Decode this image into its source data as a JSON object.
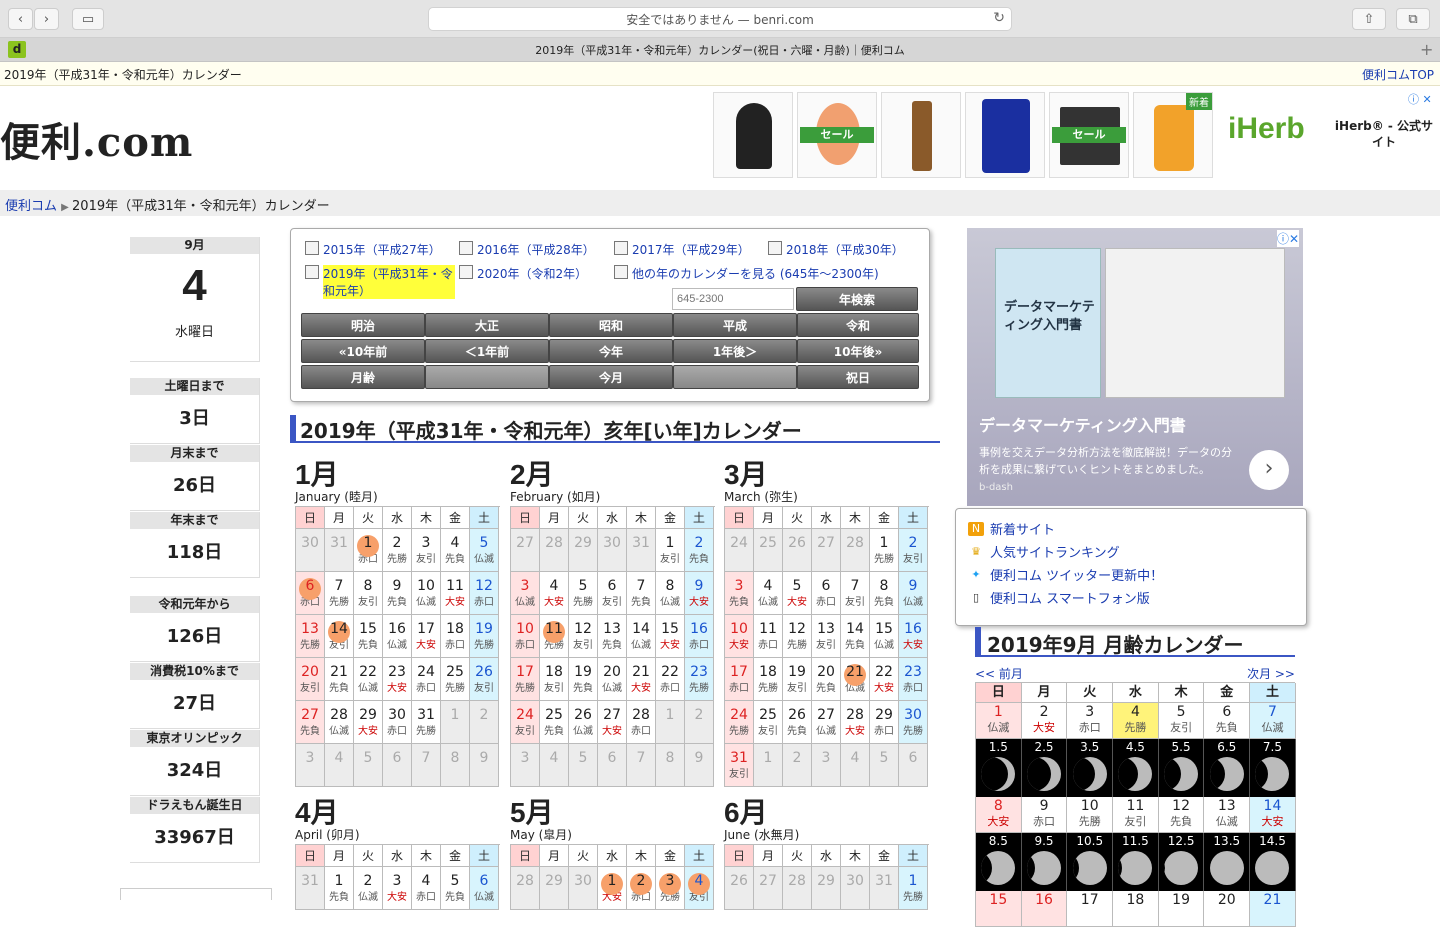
{
  "browser": {
    "url": "安全ではありません — benri.com",
    "tab_title": "2019年（平成31年・令和元年）カレンダー(祝日・六曜・月齢)｜便利コム",
    "favicon": "d"
  },
  "topbar": {
    "title": "2019年（平成31年・令和元年）カレンダー",
    "top_link": "便利コムTOP"
  },
  "header": {
    "logo": "便利.com",
    "ads": {
      "sale1": "セール",
      "sale2": "セール",
      "new": "新着",
      "iherb": "iHerb",
      "iherb_text": "iHerb® - 公式サイト"
    }
  },
  "breadcrumb": {
    "home": "便利コム",
    "current": "2019年（平成31年・令和元年）カレンダー"
  },
  "sidebar": {
    "today": {
      "month": "9月",
      "day": "4",
      "weekday": "水曜日"
    },
    "counters": [
      {
        "label": "土曜日まで",
        "value": "3日"
      },
      {
        "label": "月末まで",
        "value": "26日"
      },
      {
        "label": "年末まで",
        "value": "118日"
      },
      {
        "label": "令和元年から",
        "value": "126日"
      },
      {
        "label": "消費税10%まで",
        "value": "27日"
      },
      {
        "label": "東京オリンピック",
        "value": "324日"
      },
      {
        "label": "ドラえもん誕生日",
        "value": "33967日"
      }
    ]
  },
  "panel": {
    "years": [
      "2015年（平成27年）",
      "2016年（平成28年）",
      "2017年（平成29年）",
      "2018年（平成30年）",
      "2019年（平成31年・令和元年）",
      "2020年（令和2年）",
      "他の年のカレンダーを見る (645年〜2300年)"
    ],
    "year_placeholder": "645-2300",
    "search_button": "年検索",
    "row1": [
      "明治",
      "大正",
      "昭和",
      "平成",
      "令和"
    ],
    "row2": [
      "«10年前",
      "＜1年前",
      "今年",
      "1年後＞",
      "10年後»"
    ],
    "row3": [
      "月齢",
      "",
      "今月",
      "",
      "祝日"
    ]
  },
  "year_heading": "2019年（平成31年・令和元年）亥年[い年]カレンダー",
  "weekdays": [
    "日",
    "月",
    "火",
    "水",
    "木",
    "金",
    "土"
  ],
  "months": [
    {
      "name": "1月",
      "sub": "January (睦月)",
      "days": [
        [
          "30",
          "",
          ""
        ],
        [
          "31",
          "",
          ""
        ],
        [
          "1",
          "赤口",
          "h"
        ],
        [
          "2",
          "先勝",
          ""
        ],
        [
          "3",
          "友引",
          ""
        ],
        [
          "4",
          "先負",
          ""
        ],
        [
          "5",
          "仏滅",
          ""
        ],
        [
          "6",
          "赤口",
          "h"
        ],
        [
          "7",
          "先勝",
          ""
        ],
        [
          "8",
          "友引",
          ""
        ],
        [
          "9",
          "先負",
          ""
        ],
        [
          "10",
          "仏滅",
          ""
        ],
        [
          "11",
          "大安",
          ""
        ],
        [
          "12",
          "赤口",
          ""
        ],
        [
          "13",
          "先勝",
          ""
        ],
        [
          "14",
          "友引",
          "h"
        ],
        [
          "15",
          "先負",
          ""
        ],
        [
          "16",
          "仏滅",
          ""
        ],
        [
          "17",
          "大安",
          ""
        ],
        [
          "18",
          "赤口",
          ""
        ],
        [
          "19",
          "先勝",
          ""
        ],
        [
          "20",
          "友引",
          ""
        ],
        [
          "21",
          "先負",
          ""
        ],
        [
          "22",
          "仏滅",
          ""
        ],
        [
          "23",
          "大安",
          ""
        ],
        [
          "24",
          "赤口",
          ""
        ],
        [
          "25",
          "先勝",
          ""
        ],
        [
          "26",
          "友引",
          ""
        ],
        [
          "27",
          "先負",
          ""
        ],
        [
          "28",
          "仏滅",
          ""
        ],
        [
          "29",
          "大安",
          ""
        ],
        [
          "30",
          "赤口",
          ""
        ],
        [
          "31",
          "先勝",
          ""
        ],
        [
          "1",
          "",
          ""
        ],
        [
          "2",
          "",
          ""
        ],
        [
          "3",
          "",
          ""
        ],
        [
          "4",
          "",
          ""
        ],
        [
          "5",
          "",
          ""
        ],
        [
          "6",
          "",
          ""
        ],
        [
          "7",
          "",
          ""
        ],
        [
          "8",
          "",
          ""
        ],
        [
          "9",
          "",
          ""
        ]
      ]
    },
    {
      "name": "2月",
      "sub": "February (如月)",
      "days": [
        [
          "27",
          "",
          ""
        ],
        [
          "28",
          "",
          ""
        ],
        [
          "29",
          "",
          ""
        ],
        [
          "30",
          "",
          ""
        ],
        [
          "31",
          "",
          ""
        ],
        [
          "1",
          "友引",
          ""
        ],
        [
          "2",
          "先負",
          ""
        ],
        [
          "3",
          "仏滅",
          ""
        ],
        [
          "4",
          "大安",
          ""
        ],
        [
          "5",
          "先勝",
          ""
        ],
        [
          "6",
          "友引",
          ""
        ],
        [
          "7",
          "先負",
          ""
        ],
        [
          "8",
          "仏滅",
          ""
        ],
        [
          "9",
          "大安",
          ""
        ],
        [
          "10",
          "赤口",
          ""
        ],
        [
          "11",
          "先勝",
          "h"
        ],
        [
          "12",
          "友引",
          ""
        ],
        [
          "13",
          "先負",
          ""
        ],
        [
          "14",
          "仏滅",
          ""
        ],
        [
          "15",
          "大安",
          ""
        ],
        [
          "16",
          "赤口",
          ""
        ],
        [
          "17",
          "先勝",
          ""
        ],
        [
          "18",
          "友引",
          ""
        ],
        [
          "19",
          "先負",
          ""
        ],
        [
          "20",
          "仏滅",
          ""
        ],
        [
          "21",
          "大安",
          ""
        ],
        [
          "22",
          "赤口",
          ""
        ],
        [
          "23",
          "先勝",
          ""
        ],
        [
          "24",
          "友引",
          ""
        ],
        [
          "25",
          "先負",
          ""
        ],
        [
          "26",
          "仏滅",
          ""
        ],
        [
          "27",
          "大安",
          ""
        ],
        [
          "28",
          "赤口",
          ""
        ],
        [
          "1",
          "",
          ""
        ],
        [
          "2",
          "",
          ""
        ],
        [
          "3",
          "",
          ""
        ],
        [
          "4",
          "",
          ""
        ],
        [
          "5",
          "",
          ""
        ],
        [
          "6",
          "",
          ""
        ],
        [
          "7",
          "",
          ""
        ],
        [
          "8",
          "",
          ""
        ],
        [
          "9",
          "",
          ""
        ]
      ]
    },
    {
      "name": "3月",
      "sub": "March (弥生)",
      "days": [
        [
          "24",
          "",
          ""
        ],
        [
          "25",
          "",
          ""
        ],
        [
          "26",
          "",
          ""
        ],
        [
          "27",
          "",
          ""
        ],
        [
          "28",
          "",
          ""
        ],
        [
          "1",
          "先勝",
          ""
        ],
        [
          "2",
          "友引",
          ""
        ],
        [
          "3",
          "先負",
          ""
        ],
        [
          "4",
          "仏滅",
          ""
        ],
        [
          "5",
          "大安",
          ""
        ],
        [
          "6",
          "赤口",
          ""
        ],
        [
          "7",
          "友引",
          ""
        ],
        [
          "8",
          "先負",
          ""
        ],
        [
          "9",
          "仏滅",
          ""
        ],
        [
          "10",
          "大安",
          ""
        ],
        [
          "11",
          "赤口",
          ""
        ],
        [
          "12",
          "先勝",
          ""
        ],
        [
          "13",
          "友引",
          ""
        ],
        [
          "14",
          "先負",
          ""
        ],
        [
          "15",
          "仏滅",
          ""
        ],
        [
          "16",
          "大安",
          ""
        ],
        [
          "17",
          "赤口",
          ""
        ],
        [
          "18",
          "先勝",
          ""
        ],
        [
          "19",
          "友引",
          ""
        ],
        [
          "20",
          "先負",
          ""
        ],
        [
          "21",
          "仏滅",
          "h"
        ],
        [
          "22",
          "大安",
          ""
        ],
        [
          "23",
          "赤口",
          ""
        ],
        [
          "24",
          "先勝",
          ""
        ],
        [
          "25",
          "友引",
          ""
        ],
        [
          "26",
          "先負",
          ""
        ],
        [
          "27",
          "仏滅",
          ""
        ],
        [
          "28",
          "大安",
          ""
        ],
        [
          "29",
          "赤口",
          ""
        ],
        [
          "30",
          "先勝",
          ""
        ],
        [
          "31",
          "友引",
          ""
        ],
        [
          "1",
          "",
          ""
        ],
        [
          "2",
          "",
          ""
        ],
        [
          "3",
          "",
          ""
        ],
        [
          "4",
          "",
          ""
        ],
        [
          "5",
          "",
          ""
        ],
        [
          "6",
          "",
          ""
        ]
      ]
    },
    {
      "name": "4月",
      "sub": "April (卯月)",
      "days": [
        [
          "31",
          "",
          ""
        ],
        [
          "1",
          "先負",
          ""
        ],
        [
          "2",
          "仏滅",
          ""
        ],
        [
          "3",
          "大安",
          ""
        ],
        [
          "4",
          "赤口",
          ""
        ],
        [
          "5",
          "先負",
          ""
        ],
        [
          "6",
          "仏滅",
          ""
        ]
      ]
    },
    {
      "name": "5月",
      "sub": "May (皐月)",
      "days": [
        [
          "28",
          "",
          ""
        ],
        [
          "29",
          "",
          ""
        ],
        [
          "30",
          "",
          ""
        ],
        [
          "1",
          "大安",
          "h"
        ],
        [
          "2",
          "赤口",
          "h"
        ],
        [
          "3",
          "先勝",
          "h"
        ],
        [
          "4",
          "友引",
          "h"
        ]
      ]
    },
    {
      "name": "6月",
      "sub": "June (水無月)",
      "days": [
        [
          "26",
          "",
          ""
        ],
        [
          "27",
          "",
          ""
        ],
        [
          "28",
          "",
          ""
        ],
        [
          "29",
          "",
          ""
        ],
        [
          "30",
          "",
          ""
        ],
        [
          "31",
          "",
          ""
        ],
        [
          "1",
          "先勝",
          ""
        ]
      ]
    }
  ],
  "adbox": {
    "title": "データマーケティング入門書",
    "desc": "事例を交えデータ分析方法を徹底解説！データの分析を成果に繋げていくヒントをまとめました。",
    "source": "b-dash",
    "book_title": "データマーケティング入門書"
  },
  "links": [
    "新着サイト",
    "人気サイトランキング",
    "便利コム ツイッター更新中！",
    "便利コム スマートフォン版"
  ],
  "moon": {
    "heading": "2019年9月 月齢カレンダー",
    "prev": "<< 前月",
    "next": "次月 >>",
    "week1": [
      [
        "1",
        "仏滅",
        "1.5"
      ],
      [
        "2",
        "大安",
        "2.5"
      ],
      [
        "3",
        "赤口",
        "3.5"
      ],
      [
        "4",
        "先勝",
        "4.5"
      ],
      [
        "5",
        "友引",
        "5.5"
      ],
      [
        "6",
        "先負",
        "6.5"
      ],
      [
        "7",
        "仏滅",
        "7.5"
      ]
    ],
    "week2": [
      [
        "8",
        "大安",
        "8.5"
      ],
      [
        "9",
        "赤口",
        "9.5"
      ],
      [
        "10",
        "先勝",
        "10.5"
      ],
      [
        "11",
        "友引",
        "11.5"
      ],
      [
        "12",
        "先負",
        "12.5"
      ],
      [
        "13",
        "仏滅",
        "13.5"
      ],
      [
        "14",
        "大安",
        "14.5"
      ]
    ],
    "week3": [
      "15",
      "16",
      "17",
      "18",
      "19",
      "20",
      "21"
    ]
  }
}
